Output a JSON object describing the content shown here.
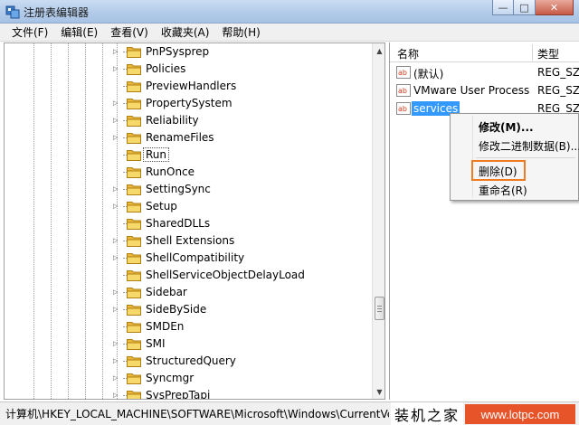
{
  "window": {
    "title": "注册表编辑器",
    "buttons": {
      "minimize": "—",
      "maximize": "□",
      "close": "✕"
    }
  },
  "menubar": {
    "items": [
      "文件(F)",
      "编辑(E)",
      "查看(V)",
      "收藏夹(A)",
      "帮助(H)"
    ]
  },
  "tree": {
    "nodes": [
      {
        "label": "PnPSysprep",
        "expandable": true
      },
      {
        "label": "Policies",
        "expandable": true
      },
      {
        "label": "PreviewHandlers",
        "expandable": false
      },
      {
        "label": "PropertySystem",
        "expandable": true
      },
      {
        "label": "Reliability",
        "expandable": true
      },
      {
        "label": "RenameFiles",
        "expandable": true
      },
      {
        "label": "Run",
        "expandable": false,
        "selected": true
      },
      {
        "label": "RunOnce",
        "expandable": false
      },
      {
        "label": "SettingSync",
        "expandable": true
      },
      {
        "label": "Setup",
        "expandable": true
      },
      {
        "label": "SharedDLLs",
        "expandable": false
      },
      {
        "label": "Shell Extensions",
        "expandable": true
      },
      {
        "label": "ShellCompatibility",
        "expandable": true
      },
      {
        "label": "ShellServiceObjectDelayLoad",
        "expandable": false
      },
      {
        "label": "Sidebar",
        "expandable": true
      },
      {
        "label": "SideBySide",
        "expandable": true
      },
      {
        "label": "SMDEn",
        "expandable": false
      },
      {
        "label": "SMI",
        "expandable": true
      },
      {
        "label": "StructuredQuery",
        "expandable": true
      },
      {
        "label": "Syncmgr",
        "expandable": true
      },
      {
        "label": "SysPrepTapi",
        "expandable": true
      }
    ]
  },
  "list": {
    "columns": {
      "name": "名称",
      "type": "类型"
    },
    "rows": [
      {
        "name": "(默认)",
        "type": "REG_SZ"
      },
      {
        "name": "VMware User Process",
        "type": "REG_SZ"
      },
      {
        "name": "services",
        "type": "REG_SZ",
        "selected": true
      }
    ]
  },
  "context_menu": {
    "items": [
      "修改(M)...",
      "修改二进制数据(B)...",
      "删除(D)",
      "重命名(R)"
    ],
    "highlighted": "删除(D)",
    "highlight_color": "#ef7b22"
  },
  "statusbar": {
    "path": "计算机\\HKEY_LOCAL_MACHINE\\SOFTWARE\\Microsoft\\Windows\\CurrentVersion\\Run"
  },
  "watermark": {
    "name": "装机之家",
    "url": "www.lotpc.com",
    "color": "#e8542a"
  }
}
